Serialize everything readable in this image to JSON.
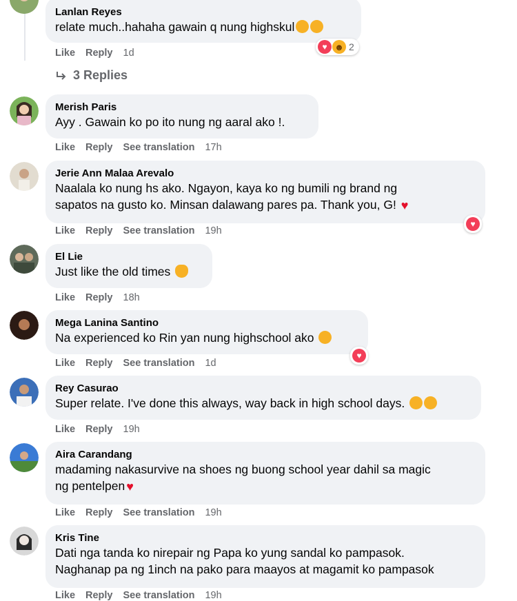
{
  "top_comment": {
    "author": "Lanlan Reyes",
    "text": "relate much..hahaha gawain q nung highskul",
    "actions": {
      "like": "Like",
      "reply": "Reply",
      "time": "1d"
    },
    "reaction_count": "2",
    "reaction_icons": [
      "love-icon",
      "haha-icon"
    ],
    "replies_label": "3 Replies"
  },
  "comments": [
    {
      "author": "Merish Paris",
      "text_lines": [
        "Ayy . Gawain ko po ito nung ng aaral ako !."
      ],
      "actions": {
        "like": "Like",
        "reply": "Reply",
        "translate": "See translation",
        "time": "17h"
      }
    },
    {
      "author": "Jerie Ann Malaa Arevalo",
      "text_lines": [
        "Naalala ko nung hs ako. Ngayon, kaya ko ng bumili ng brand ng",
        "sapatos na gusto ko. Minsan dalawang pares pa. Thank you, G!"
      ],
      "actions": {
        "like": "Like",
        "reply": "Reply",
        "translate": "See translation",
        "time": "19h"
      },
      "reaction_icons": [
        "love-icon"
      ]
    },
    {
      "author": "El Lie",
      "text_lines": [
        "Just like the old times"
      ],
      "actions": {
        "like": "Like",
        "reply": "Reply",
        "time": "18h"
      }
    },
    {
      "author": "Mega Lanina Santino",
      "text_lines": [
        "Na experienced ko Rin yan nung highschool ako"
      ],
      "actions": {
        "like": "Like",
        "reply": "Reply",
        "translate": "See translation",
        "time": "1d"
      },
      "reaction_icons": [
        "love-icon"
      ]
    },
    {
      "author": "Rey Casurao",
      "text_lines": [
        "Super relate. I've done this always, way back in high school days."
      ],
      "actions": {
        "like": "Like",
        "reply": "Reply",
        "time": "19h"
      }
    },
    {
      "author": "Aira Carandang",
      "text_lines": [
        "madaming nakasurvive na shoes ng buong school year dahil sa magic",
        "ng pentelpen"
      ],
      "actions": {
        "like": "Like",
        "reply": "Reply",
        "translate": "See translation",
        "time": "19h"
      }
    },
    {
      "author": "Kris Tine",
      "text_lines": [
        "Dati nga tanda ko nirepair ng Papa ko yung sandal ko pampasok.",
        "Naghanap pa ng 1inch na pako para maayos at magamit ko pampasok"
      ],
      "actions": {
        "like": "Like",
        "reply": "Reply",
        "translate": "See translation",
        "time": "19h"
      }
    }
  ],
  "colors": {
    "bubble": "#f0f2f5",
    "meta": "#65676b",
    "love": "#f33e58",
    "haha": "#f7b125",
    "heart": "#e4102c"
  }
}
